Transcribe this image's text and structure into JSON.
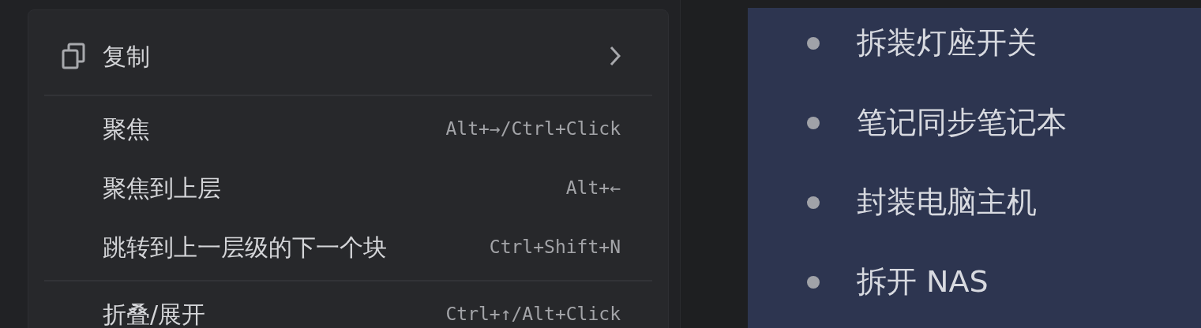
{
  "context_menu": {
    "items": [
      {
        "kind": "submenu",
        "label": "复制"
      },
      {
        "kind": "separator"
      },
      {
        "kind": "action",
        "label": "聚焦",
        "shortcut": "Alt+→/Ctrl+Click"
      },
      {
        "kind": "action",
        "label": "聚焦到上层",
        "shortcut": "Alt+←"
      },
      {
        "kind": "action",
        "label": "跳转到上一层级的下一个块",
        "shortcut": "Ctrl+Shift+N"
      },
      {
        "kind": "separator"
      },
      {
        "kind": "action",
        "label": "折叠/展开",
        "shortcut": "Ctrl+↑/Alt+Click"
      }
    ]
  },
  "outline": {
    "items": [
      "拆装灯座开关",
      "笔记同步笔记本",
      "封装电脑主机",
      "拆开 NAS"
    ]
  }
}
